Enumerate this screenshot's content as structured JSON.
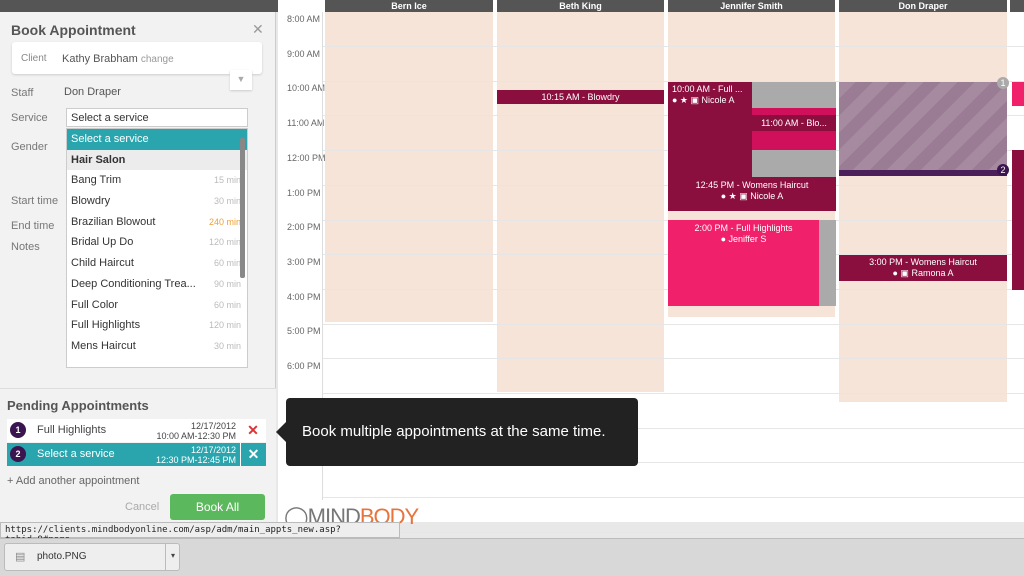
{
  "panel": {
    "title": "Book Appointment",
    "client_label": "Client",
    "client_name": "Kathy Brabham",
    "change": "change",
    "staff_label": "Staff",
    "staff_value": "Don Draper",
    "service_label": "Service",
    "service_value": "Select a service",
    "gender_label": "Gender",
    "start_label": "Start time",
    "end_label": "End time",
    "notes_label": "Notes",
    "options": [
      {
        "label": "Select a service",
        "min": ""
      },
      {
        "label": "Hair Salon",
        "min": ""
      },
      {
        "label": "Bang Trim",
        "min": "15 min"
      },
      {
        "label": "Blowdry",
        "min": "30 min"
      },
      {
        "label": "Brazilian Blowout",
        "min": "240 min"
      },
      {
        "label": "Bridal Up Do",
        "min": "120 min"
      },
      {
        "label": "Child Haircut",
        "min": "60 min"
      },
      {
        "label": "Deep Conditioning Trea...",
        "min": "90 min"
      },
      {
        "label": "Full Color",
        "min": "60 min"
      },
      {
        "label": "Full Highlights",
        "min": "120 min"
      },
      {
        "label": "Mens Haircut",
        "min": "30 min"
      }
    ]
  },
  "pending": {
    "title": "Pending Appointments",
    "rows": [
      {
        "num": "1",
        "name": "Full Highlights",
        "date": "12/17/2012",
        "time": "10:00 AM-12:30 PM"
      },
      {
        "num": "2",
        "name": "Select a service",
        "date": "12/17/2012",
        "time": "12:30 PM-12:45 PM"
      }
    ],
    "add": "+ Add another appointment",
    "cancel": "Cancel",
    "book": "Book All"
  },
  "calendar": {
    "staff": [
      "Bern Ice",
      "Beth King",
      "Jennifer Smith",
      "Don Draper"
    ],
    "times": [
      "8:00 AM",
      "9:00 AM",
      "10:00 AM",
      "11:00 AM",
      "12:00 PM",
      "1:00 PM",
      "2:00 PM",
      "3:00 PM",
      "4:00 PM",
      "5:00 PM",
      "6:00 PM"
    ],
    "appts": {
      "a1": "10:15 AM - Blowdry",
      "a2t": "10:00 AM - Full ...",
      "a2c": "Nicole A",
      "a3": "11:00 AM - Blo...",
      "a4t": "12:45 PM - Womens Haircut",
      "a4c": "Nicole A",
      "a5t": "2:00 PM - Full Highlights",
      "a5c": "Jeniffer S",
      "a6t": "3:00 PM - Womens Haircut",
      "a6c": "Ramona A",
      "b1": "1",
      "b2": "2"
    }
  },
  "tooltip": "Book multiple appointments at the same time.",
  "logo": {
    "a": "MIND",
    "b": "BODY"
  },
  "status_url": "https://clients.mindbodyonline.com/asp/adm/main_appts_new.asp?tabid=9#nogo",
  "download": "photo.PNG",
  "colors": {
    "teal": "#2aa5ae",
    "maroon": "#8b0f3e",
    "pink": "#f0216a",
    "green": "#5cb85c"
  }
}
